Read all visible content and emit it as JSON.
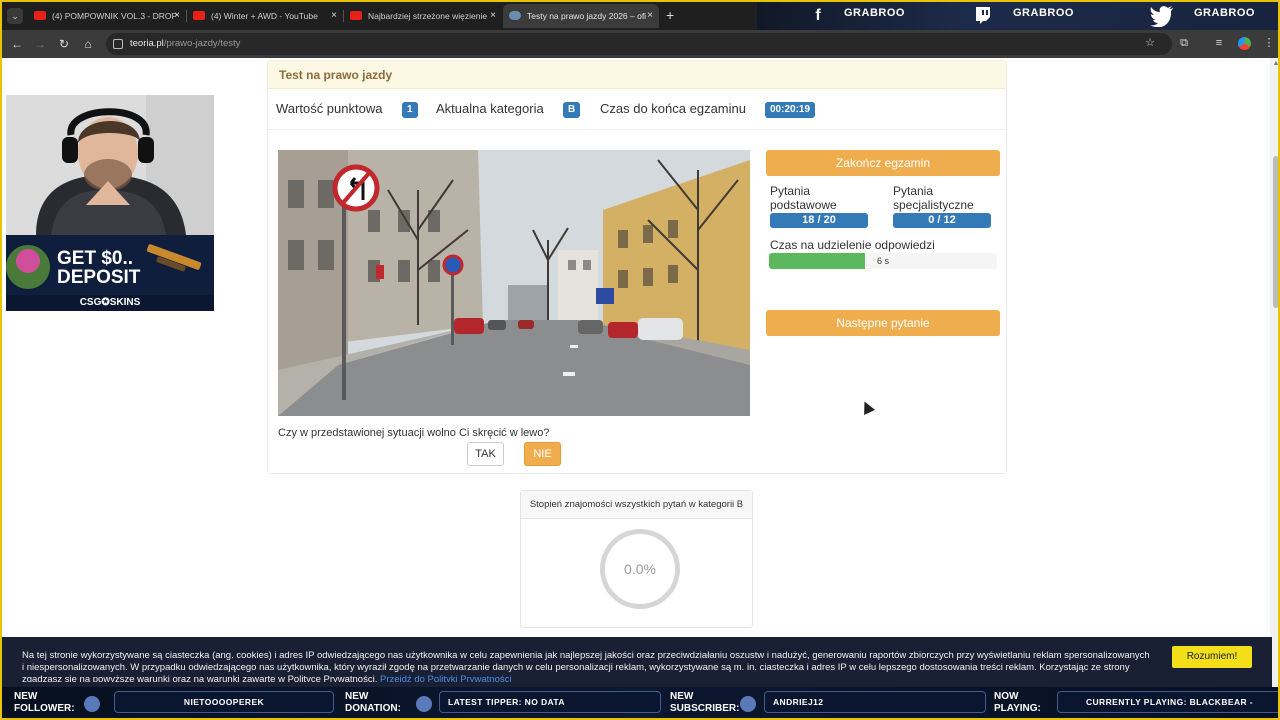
{
  "browser": {
    "tabs": [
      {
        "title": "(4) POMPOWNIK VOL.3 - DROP"
      },
      {
        "title": "(4) Winter + AWD - YouTube"
      },
      {
        "title": "Najbardziej strzeżone więzienie"
      },
      {
        "title": "Testy na prawo jazdy 2026 – ofi"
      }
    ],
    "close_glyph": "×",
    "new_tab_glyph": "+",
    "url": {
      "host": "teoria.pl",
      "path": "/prawo-jazdy/testy"
    }
  },
  "social": {
    "facebook": {
      "icon": "facebook-icon",
      "handle": "GRABROO"
    },
    "twitch": {
      "icon": "twitch-icon",
      "handle": "GRABROO"
    },
    "twitter": {
      "icon": "twitter-icon",
      "handle": "GRABROO"
    }
  },
  "exam": {
    "header": "Test na prawo jazdy",
    "points_label": "Wartość punktowa",
    "points_value": "1",
    "category_label": "Aktualna kategoria",
    "category_value": "B",
    "time_label": "Czas do końca egzaminu",
    "time_value": "00:20:19",
    "question": "Czy w przedstawionej sytuacji wolno Ci skręcić w lewo?",
    "answers": {
      "yes": "TAK",
      "no": "NIE"
    },
    "end_button": "Zakończ egzamin",
    "basic_label_1": "Pytania",
    "basic_label_2": "podstawowe",
    "basic_value": "18 / 20",
    "specialist_label_1": "Pytania",
    "specialist_label_2": "specjalistyczne",
    "specialist_value": "0 / 12",
    "answer_time_label": "Czas na udzielenie odpowiedzi",
    "answer_time_value": "6 s",
    "answer_time_fraction": 0.42,
    "next_button": "Następne pytanie"
  },
  "stats": {
    "title": "Stopień znajomości wszystkich pytań w kategorii B",
    "percent": "0.0%"
  },
  "cookie": {
    "text": "Na tej stronie wykorzystywane są ciasteczka (ang. cookies) i adres IP odwiedzającego nas użytkownika w celu zapewnienia jak najlepszej jakości oraz przeciwdziałaniu oszustw i nadużyć, generowaniu raportów zbiorczych przy wyświetlaniu reklam spersonalizowanych i niespersonalizowanych. W przypadku odwiedzającego nas użytkownika, który wyraził zgodę na przetwarzanie danych w celu personalizacji reklam, wykorzystywane są m. in. ciasteczka i adres IP w celu lepszego dostosowania treści reklam. Korzystając ze strony zgadzasz się na powyższe warunki oraz na warunki zawarte w Polityce Prywatności.",
    "link": "Przejdź do Polityki Prywatności",
    "button": "Rozumiem!"
  },
  "ad": {
    "line1": "GET $0..",
    "line2": "DEPOSIT",
    "brand": "CSG✪SKINS"
  },
  "stream": {
    "follower_label_1": "NEW",
    "follower_label_2": "FOLLOWER:",
    "follower_value": "NIETOOOOPEREK",
    "donation_label_1": "NEW",
    "donation_label_2": "DONATION:",
    "donation_value": "LATEST TIPPER: NO DATA",
    "subscriber_label_1": "NEW",
    "subscriber_label_2": "SUBSCRIBER:",
    "subscriber_value": "ANDRIEJ12",
    "playing_label_1": "NOW",
    "playing_label_2": "PLAYING:",
    "playing_value": "CURRENTLY PLAYING: BLACKBEAR -"
  },
  "colors": {
    "warning": "#f0ad4e",
    "primary": "#337ab7",
    "success": "#5cb85c",
    "cookie_button": "#f2df1a"
  }
}
